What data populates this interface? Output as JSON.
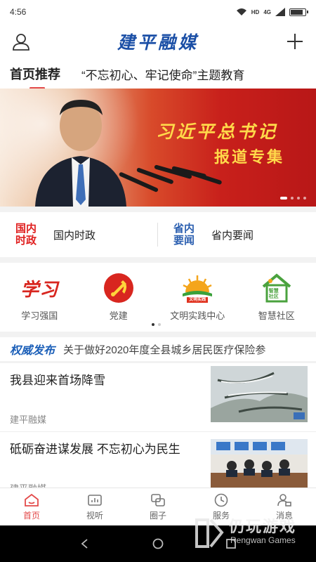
{
  "status_bar": {
    "time": "4:56",
    "network": "4G",
    "hd": "HD"
  },
  "header": {
    "title": "建平融媒"
  },
  "tabs": [
    {
      "label": "首页推荐"
    },
    {
      "label": "“不忘初心、牢记使命”主题教育"
    }
  ],
  "banner": {
    "line1": "习近平总书记",
    "line2": "报道专集"
  },
  "news_categories": [
    {
      "badge_top": "国内",
      "badge_bottom": "时政",
      "label": "国内时政",
      "color": "#e02020"
    },
    {
      "badge_top": "省内",
      "badge_bottom": "要闻",
      "label": "省内要闻",
      "color": "#2b5fb0"
    }
  ],
  "shortcuts": [
    {
      "label": "学习强国",
      "icon": "xuexi-logo-icon"
    },
    {
      "label": "党建",
      "icon": "party-emblem-icon"
    },
    {
      "label": "文明实践中心",
      "icon": "civilization-practice-icon",
      "badge": "文明实践"
    },
    {
      "label": "智慧社区",
      "icon": "smart-community-icon",
      "badge_top": "智慧",
      "badge_bottom": "社区"
    }
  ],
  "shortcut_logo_text": "学习",
  "notice": {
    "tag": "权威发布",
    "text": "关于做好2020年度全县城乡居民医疗保险参"
  },
  "news": [
    {
      "title": "我县迎来首场降雪",
      "source": "建平融媒"
    },
    {
      "title": "砥砺奋进谋发展 不忘初心为民生",
      "source": "建平融媒"
    }
  ],
  "bottom_nav": [
    {
      "label": "首页",
      "icon": "home-icon",
      "active": true
    },
    {
      "label": "视听",
      "icon": "video-icon",
      "active": false
    },
    {
      "label": "圈子",
      "icon": "circle-icon",
      "active": false
    },
    {
      "label": "服务",
      "icon": "clock-icon",
      "active": false
    },
    {
      "label": "消息",
      "icon": "user-message-icon",
      "active": false
    }
  ],
  "watermark": {
    "text": "仍玩游戏",
    "sub": "Rengwan Games"
  },
  "colors": {
    "brand_blue": "#1b4fa6",
    "accent_red": "#e34a4a"
  }
}
